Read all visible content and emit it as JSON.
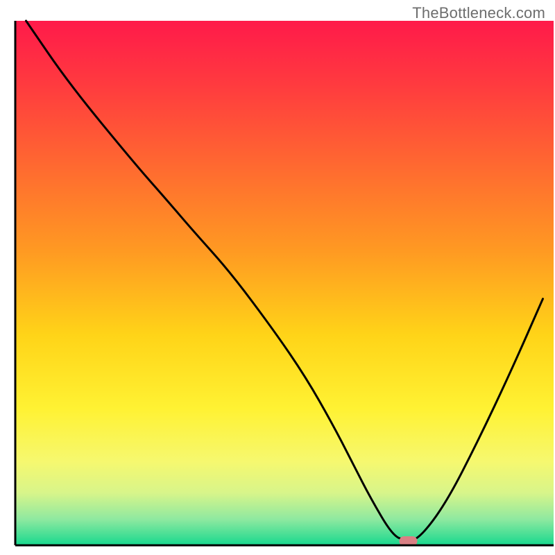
{
  "watermark": {
    "text": "TheBottleneck.com"
  },
  "chart_data": {
    "type": "line",
    "title": "",
    "xlabel": "",
    "ylabel": "",
    "xlim": [
      0,
      100
    ],
    "ylim": [
      0,
      100
    ],
    "grid": false,
    "legend": false,
    "background": {
      "type": "vertical-gradient",
      "stops": [
        {
          "offset": 0.0,
          "color": "#ff1a4a"
        },
        {
          "offset": 0.12,
          "color": "#ff3a3f"
        },
        {
          "offset": 0.28,
          "color": "#ff6a30"
        },
        {
          "offset": 0.44,
          "color": "#ff9a22"
        },
        {
          "offset": 0.6,
          "color": "#ffd418"
        },
        {
          "offset": 0.74,
          "color": "#fff233"
        },
        {
          "offset": 0.84,
          "color": "#f6f86f"
        },
        {
          "offset": 0.9,
          "color": "#d8f58a"
        },
        {
          "offset": 0.95,
          "color": "#8fe9a0"
        },
        {
          "offset": 1.0,
          "color": "#17d88e"
        }
      ]
    },
    "series": [
      {
        "name": "bottleneck-curve",
        "color": "#000000",
        "x": [
          2,
          10,
          22,
          28,
          33,
          40,
          48,
          54,
          59,
          63,
          66,
          70,
          72.5,
          75,
          80,
          86,
          92,
          98
        ],
        "values": [
          100,
          88,
          73,
          66,
          60,
          52,
          41,
          32,
          23,
          15,
          9,
          2,
          0.8,
          1.2,
          8,
          20,
          33,
          47
        ]
      }
    ],
    "marker": {
      "name": "optimal-point",
      "x": 73,
      "y": 0.8,
      "color": "#d98084"
    }
  }
}
